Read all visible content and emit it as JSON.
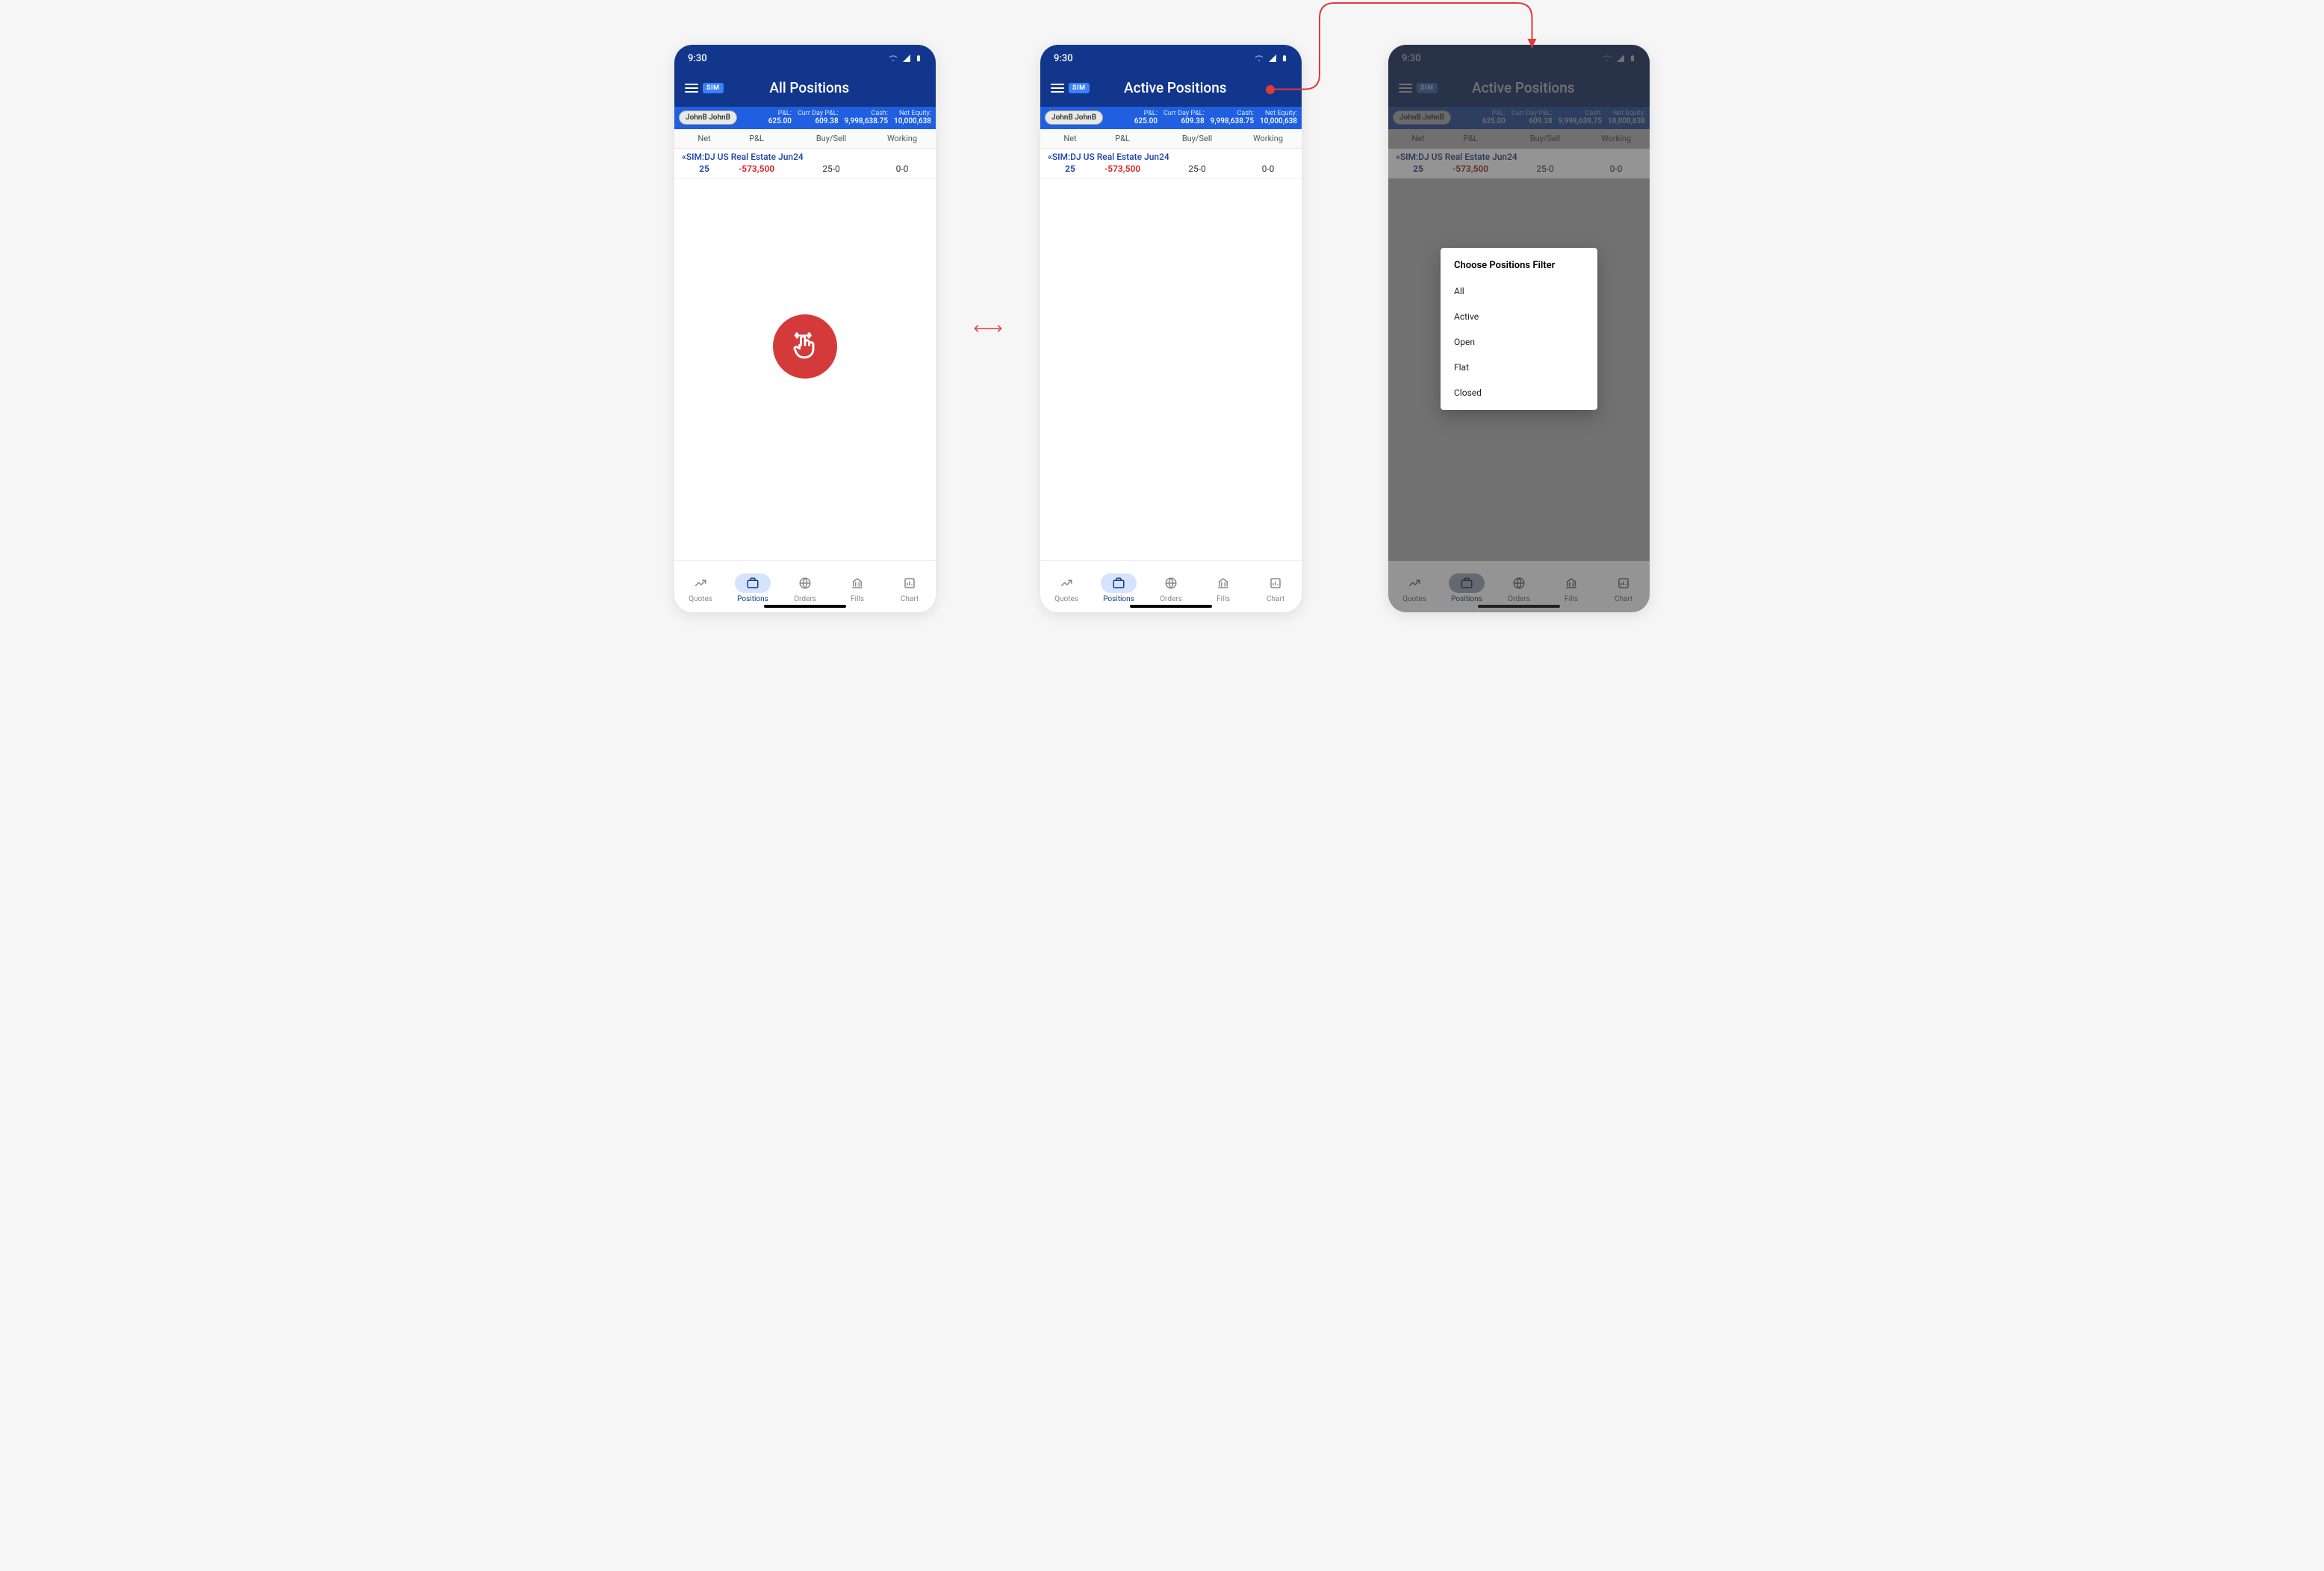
{
  "status": {
    "time": "9:30"
  },
  "header": {
    "sim_badge": "SIM",
    "title1": "All Positions",
    "title2": "Active Positions",
    "title3": "Active Positions"
  },
  "summary": {
    "user": "JohnB JohnB",
    "cols": [
      {
        "label": "P&L:",
        "value": "625.00"
      },
      {
        "label": "Curr Day P&L:",
        "value": "609.38"
      },
      {
        "label": "Cash:",
        "value": "9,998,638.75"
      },
      {
        "label": "Net Equity:",
        "value": "10,000,638"
      }
    ]
  },
  "table": {
    "headers": {
      "net": "Net",
      "pl": "P&L",
      "bs": "Buy/Sell",
      "wrk": "Working"
    },
    "row": {
      "name": "«SIM:DJ US Real Estate Jun24",
      "net": "25",
      "pl": "-573,500",
      "bs": "25-0",
      "wrk": "0-0"
    }
  },
  "nav": {
    "quotes": "Quotes",
    "positions": "Positions",
    "orders": "Orders",
    "fills": "Fills",
    "chart": "Chart"
  },
  "dialog": {
    "title": "Choose Positions Filter",
    "items": [
      "All",
      "Active",
      "Open",
      "Flat",
      "Closed"
    ]
  }
}
